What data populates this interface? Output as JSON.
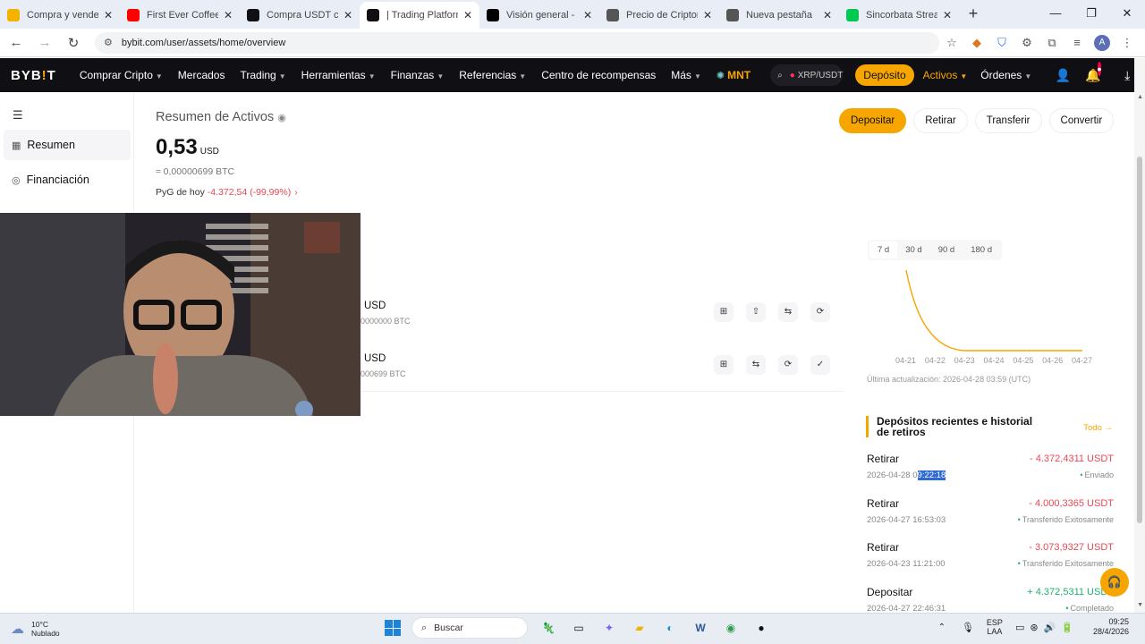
{
  "browser": {
    "tabs": [
      {
        "label": "Compra y vende Tet",
        "favicon_color": "#f5b300"
      },
      {
        "label": "First Ever Coffee Par",
        "favicon_color": "#ff0000"
      },
      {
        "label": "Compra USDT con A",
        "favicon_color": "#101014"
      },
      {
        "label": "| Trading Platform",
        "favicon_color": "#101014",
        "active": true
      },
      {
        "label": "Visión general - El e",
        "favicon_color": "#000000"
      },
      {
        "label": "Precio de Criptomon",
        "favicon_color": "#555555"
      },
      {
        "label": "Nueva pestaña",
        "favicon_color": "#555555"
      },
      {
        "label": "Sincorbata Strea",
        "favicon_color": "#00c853"
      }
    ],
    "url": "bybit.com/user/assets/home/overview",
    "profile_initial": "A"
  },
  "header": {
    "logo": "BYB!T",
    "nav": [
      {
        "label": "Comprar Cripto",
        "dropdown": true
      },
      {
        "label": "Mercados",
        "dropdown": false
      },
      {
        "label": "Trading",
        "dropdown": true
      },
      {
        "label": "Herramientas",
        "dropdown": true
      },
      {
        "label": "Finanzas",
        "dropdown": true
      },
      {
        "label": "Referencias",
        "dropdown": true
      },
      {
        "label": "Centro de recompensas",
        "dropdown": false
      },
      {
        "label": "Más",
        "dropdown": true
      }
    ],
    "mnt": "MNT",
    "search_pair": "XRP/USDT",
    "deposit": "Depósito",
    "activos": "Activos",
    "ordenes": "Órdenes"
  },
  "sidebar": {
    "items": [
      {
        "label": "Resumen",
        "active": true
      },
      {
        "label": "Financiación",
        "active": false
      }
    ]
  },
  "summary": {
    "title": "Resumen de Activos",
    "balance": "0,53",
    "balance_unit": "USD",
    "btc_equiv": "≈ 0,00000699 BTC",
    "pnl_label": "PyG de hoy",
    "pnl_value": "-4.372,54 (-99,99%)"
  },
  "actions": [
    "Depositar",
    "Retirar",
    "Transferir",
    "Convertir"
  ],
  "accounts": [
    {
      "value": "USD",
      "sub": "0000000 BTC"
    },
    {
      "value": "USD",
      "sub": "000699 BTC"
    }
  ],
  "chart": {
    "periods": [
      "7 d",
      "30 d",
      "90 d",
      "180 d"
    ],
    "active_period": "7 d",
    "update_note": "Última actualización: 2026-04-28 03:59 (UTC)"
  },
  "chart_data": {
    "type": "line",
    "x": [
      "04-21",
      "04-22",
      "04-23",
      "04-24",
      "04-25",
      "04-26",
      "04-27"
    ],
    "values": [
      4372.5,
      1500,
      0.53,
      0.53,
      0.53,
      0.53,
      0.53
    ],
    "color": "#f7a600",
    "grid": false
  },
  "recent": {
    "title": "Depósitos recientes e historial de retiros",
    "all_link": "Todo",
    "items": [
      {
        "type": "Retirar",
        "amount": "- 4.372,4311 USDT",
        "date_prefix": "2026-04-28 0",
        "date_highlight": "9:22:18",
        "status": "Enviado",
        "sign": "neg"
      },
      {
        "type": "Retirar",
        "amount": "- 4.000,3365 USDT",
        "date_prefix": "2026-04-27 16:53:03",
        "date_highlight": "",
        "status": "Transferido Exitosamente",
        "sign": "neg"
      },
      {
        "type": "Retirar",
        "amount": "- 3.073,9327 USDT",
        "date_prefix": "2026-04-23 11:21:00",
        "date_highlight": "",
        "status": "Transferido Exitosamente",
        "sign": "neg"
      },
      {
        "type": "Depositar",
        "amount": "+ 4.372,5311 USDT",
        "date_prefix": "2026-04-27 22:46:31",
        "date_highlight": "",
        "status": "Completado",
        "sign": "pos"
      }
    ]
  },
  "taskbar": {
    "temp": "10°C",
    "weather": "Nublado",
    "search": "Buscar",
    "lang1": "ESP",
    "lang2": "LAA",
    "time": "09:25",
    "date": "28/4/2026"
  }
}
